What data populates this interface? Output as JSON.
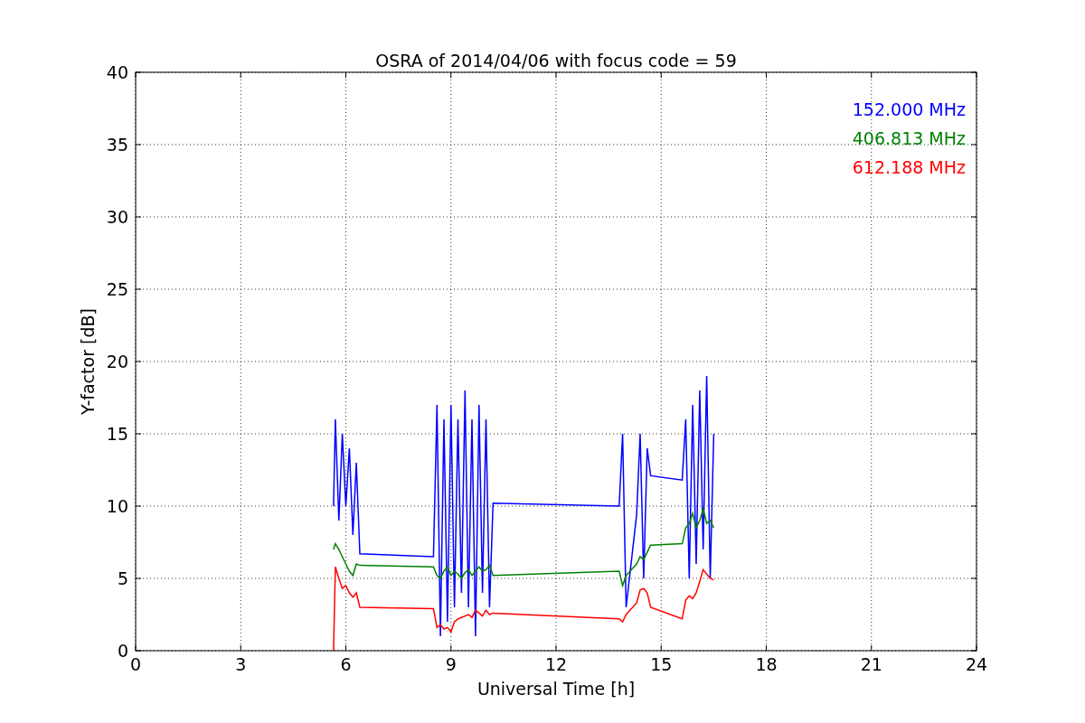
{
  "chart_data": {
    "type": "line",
    "grid": true,
    "title": "OSRA of 2014/04/06 with focus code = 59",
    "xlabel": "Universal Time [h]",
    "ylabel": "Y-factor [dB]",
    "xlim": [
      0,
      24
    ],
    "ylim": [
      0,
      40
    ],
    "xticks": [
      0,
      3,
      6,
      9,
      12,
      15,
      18,
      21,
      24
    ],
    "yticks": [
      0,
      5,
      10,
      15,
      20,
      25,
      30,
      35,
      40
    ],
    "x": [
      5.65,
      5.7,
      5.8,
      5.9,
      6.0,
      6.1,
      6.2,
      6.3,
      6.4,
      8.5,
      8.6,
      8.7,
      8.8,
      8.9,
      9.0,
      9.1,
      9.2,
      9.3,
      9.4,
      9.5,
      9.6,
      9.7,
      9.8,
      9.9,
      10.0,
      10.1,
      10.2,
      13.8,
      13.9,
      14.0,
      14.3,
      14.4,
      14.5,
      14.6,
      14.7,
      15.6,
      15.7,
      15.8,
      15.9,
      16.0,
      16.1,
      16.2,
      16.3,
      16.4,
      16.5
    ],
    "series": [
      {
        "name": "152.000 MHz",
        "color": "#0000ff",
        "values": [
          10,
          16,
          9,
          15,
          10,
          14,
          8,
          13,
          6.7,
          6.5,
          17,
          1,
          16,
          2,
          17,
          3,
          16,
          4,
          18,
          3,
          16,
          1,
          17,
          4,
          16,
          3,
          10.2,
          10,
          15,
          3,
          9.4,
          15,
          5,
          14,
          12.1,
          11.8,
          16,
          5,
          17,
          6,
          18,
          7,
          19,
          5,
          15
        ]
      },
      {
        "name": "406.813 MHz",
        "color": "#008000",
        "values": [
          7,
          7.4,
          7,
          6.5,
          6,
          5.5,
          5.2,
          6,
          5.9,
          5.8,
          5.2,
          5,
          5.5,
          5.8,
          5.2,
          5.5,
          5.3,
          5,
          5.4,
          5.6,
          5.2,
          5.5,
          5.8,
          5.5,
          5.6,
          5.9,
          5.2,
          5.5,
          4.5,
          5.2,
          6,
          6.5,
          6.3,
          6.8,
          7.3,
          7.4,
          8.5,
          8.8,
          9.5,
          8.5,
          9,
          9.8,
          8.8,
          9,
          8.5
        ]
      },
      {
        "name": "612.188 MHz",
        "color": "#ff0000",
        "values": [
          0,
          5.8,
          5,
          4.3,
          4.5,
          4,
          3.7,
          4,
          3,
          2.9,
          1.6,
          1.8,
          1.5,
          1.6,
          1.3,
          2,
          2.2,
          2.3,
          2.4,
          2.5,
          2.3,
          2.8,
          2.6,
          2.4,
          2.8,
          2.5,
          2.6,
          2.2,
          2,
          2.5,
          3.3,
          4.2,
          4.3,
          4,
          3,
          2.2,
          3.5,
          3.8,
          3.6,
          4,
          4.8,
          5.6,
          5.3,
          5,
          4.9
        ]
      }
    ]
  }
}
